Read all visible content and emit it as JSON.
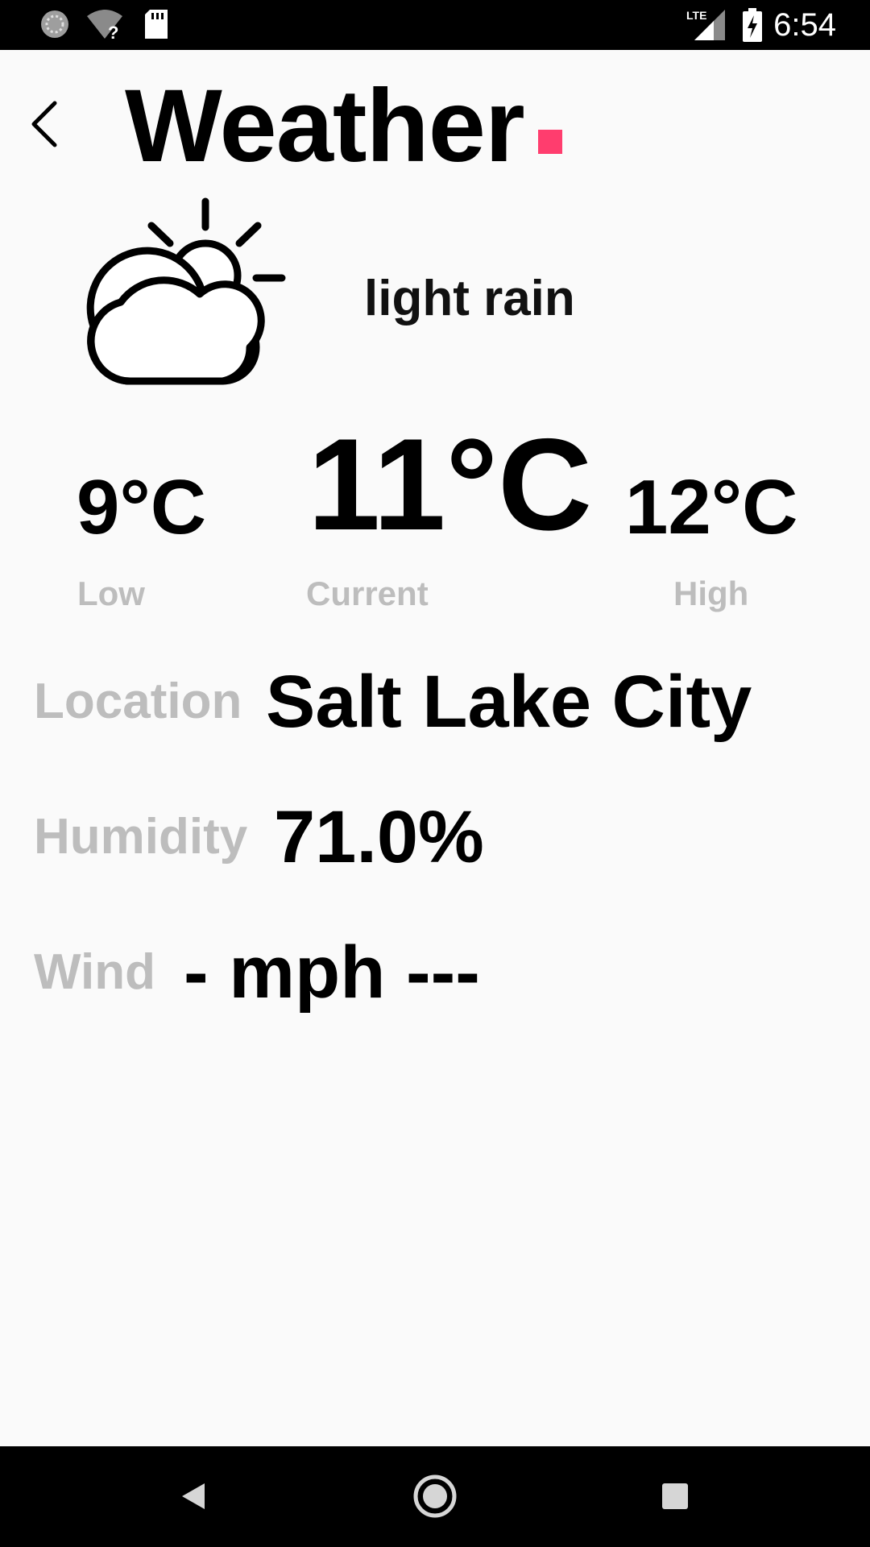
{
  "status_bar": {
    "time": "6:54",
    "network": "LTE",
    "icons": [
      "sync-icon",
      "wifi-unknown-icon",
      "sd-card-icon",
      "lte-signal-icon",
      "battery-charging-icon"
    ]
  },
  "header": {
    "title": "Weather",
    "back_icon": "chevron-left-icon",
    "accent_color": "#ff3d6e"
  },
  "weather": {
    "icon": "partly-cloudy-icon",
    "condition": "light rain"
  },
  "temperatures": {
    "low": {
      "value": "9°C",
      "label": "Low"
    },
    "current": {
      "value": "11°C",
      "label": "Current"
    },
    "high": {
      "value": "12°C",
      "label": "High"
    }
  },
  "details": {
    "location": {
      "label": "Location",
      "value": "Salt Lake City"
    },
    "humidity": {
      "label": "Humidity",
      "value": "71.0%"
    },
    "wind": {
      "label": "Wind",
      "value": "- mph ---"
    }
  },
  "nav_bar": {
    "buttons": [
      "back-triangle-icon",
      "home-circle-icon",
      "recents-square-icon"
    ]
  },
  "colors": {
    "background": "#fafafa",
    "label_gray": "#bdbdbd",
    "text": "#000000",
    "bars": "#000000"
  }
}
